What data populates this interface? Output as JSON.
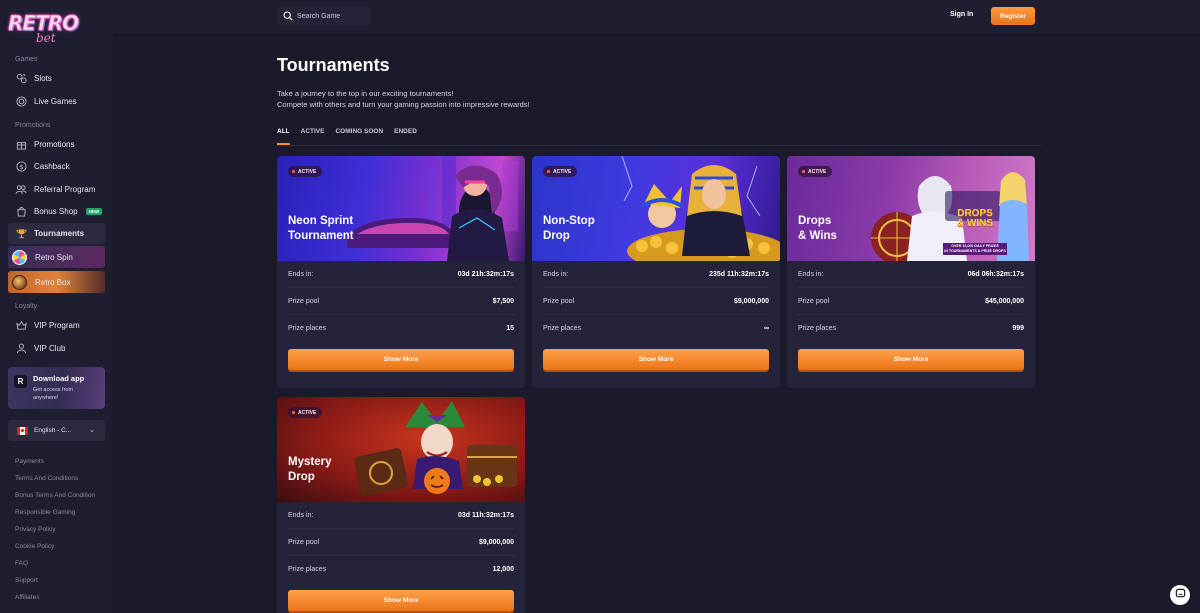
{
  "brand": {
    "word1": "RETRO",
    "word2": "bet"
  },
  "sidebar": {
    "games_label": "Games",
    "games": [
      {
        "label": "Slots",
        "icon": "slots-icon"
      },
      {
        "label": "Live Games",
        "icon": "live-games-icon"
      }
    ],
    "promotions_label": "Promotions",
    "promotions": [
      {
        "label": "Promotions",
        "icon": "gift-icon"
      },
      {
        "label": "Cashback",
        "icon": "cashback-icon"
      },
      {
        "label": "Referral Program",
        "icon": "referral-icon"
      },
      {
        "label": "Bonus Shop",
        "icon": "shop-icon",
        "badge": "NEW"
      },
      {
        "label": "Tournaments",
        "icon": "trophy-icon"
      },
      {
        "label": "Retro Spin",
        "icon": "wheel-icon"
      },
      {
        "label": "Retro Box",
        "icon": "box-icon"
      }
    ],
    "loyalty_label": "Loyalty",
    "loyalty": [
      {
        "label": "VIP Program",
        "icon": "vip-icon"
      },
      {
        "label": "VIP Club",
        "icon": "club-icon"
      }
    ],
    "download": {
      "title": "Download app",
      "subtitle": "Get access from anywhere!",
      "icon_letter": "R"
    },
    "language": "English - C...",
    "footer_links": [
      "Payments",
      "Terms And Conditions",
      "Bonus Terms And Condition",
      "Responsible Gaming",
      "Privacy Policy",
      "Cookie Policy",
      "FAQ",
      "Support",
      "Affiliates"
    ]
  },
  "header": {
    "search_placeholder": "Search Game",
    "signin": "Sign In",
    "register": "Register"
  },
  "main": {
    "title": "Tournaments",
    "desc_line1": "Take a journey to the top in our exciting tournaments!",
    "desc_line2": "Compete with others and turn your gaming passion into impressive rewards!",
    "tabs": [
      "ALL",
      "ACTIVE",
      "COMING SOON",
      "ENDED"
    ],
    "labels": {
      "ends_in": "Ends in:",
      "prize_pool": "Prize pool",
      "prize_places": "Prize places",
      "show_more": "Show More"
    },
    "cards": [
      {
        "status": "ACTIVE",
        "title_l1": "Neon Sprint",
        "title_l2": "Tournament",
        "ends_in": "03d 21h:32m:17s",
        "prize_pool": "$7,500",
        "prize_places": "15"
      },
      {
        "status": "ACTIVE",
        "title_l1": "Non-Stop",
        "title_l2": "Drop",
        "ends_in": "235d 11h:32m:17s",
        "prize_pool": "$9,000,000",
        "prize_places": "∞"
      },
      {
        "status": "ACTIVE",
        "title_l1": "Drops",
        "title_l2": "& Wins",
        "ends_in": "06d 06h:32m:17s",
        "prize_pool": "$45,000,000",
        "prize_places": "999",
        "art_text1": "DROPS",
        "art_text2": "& WINS",
        "art_text3": "OVER 10,000 DAILY PRIZES",
        "art_text4": "IN TOURNAMENTS & PRIZE DROPS"
      },
      {
        "status": "ACTIVE",
        "title_l1": "Mystery",
        "title_l2": "Drop",
        "ends_in": "03d 11h:32m:17s",
        "prize_pool": "$9,000,000",
        "prize_places": "12,000"
      }
    ]
  },
  "colors": {
    "accent": "#ff8a2b",
    "background": "#1b1a2b",
    "sidebar": "#1f1e30",
    "card": "#24233a"
  }
}
